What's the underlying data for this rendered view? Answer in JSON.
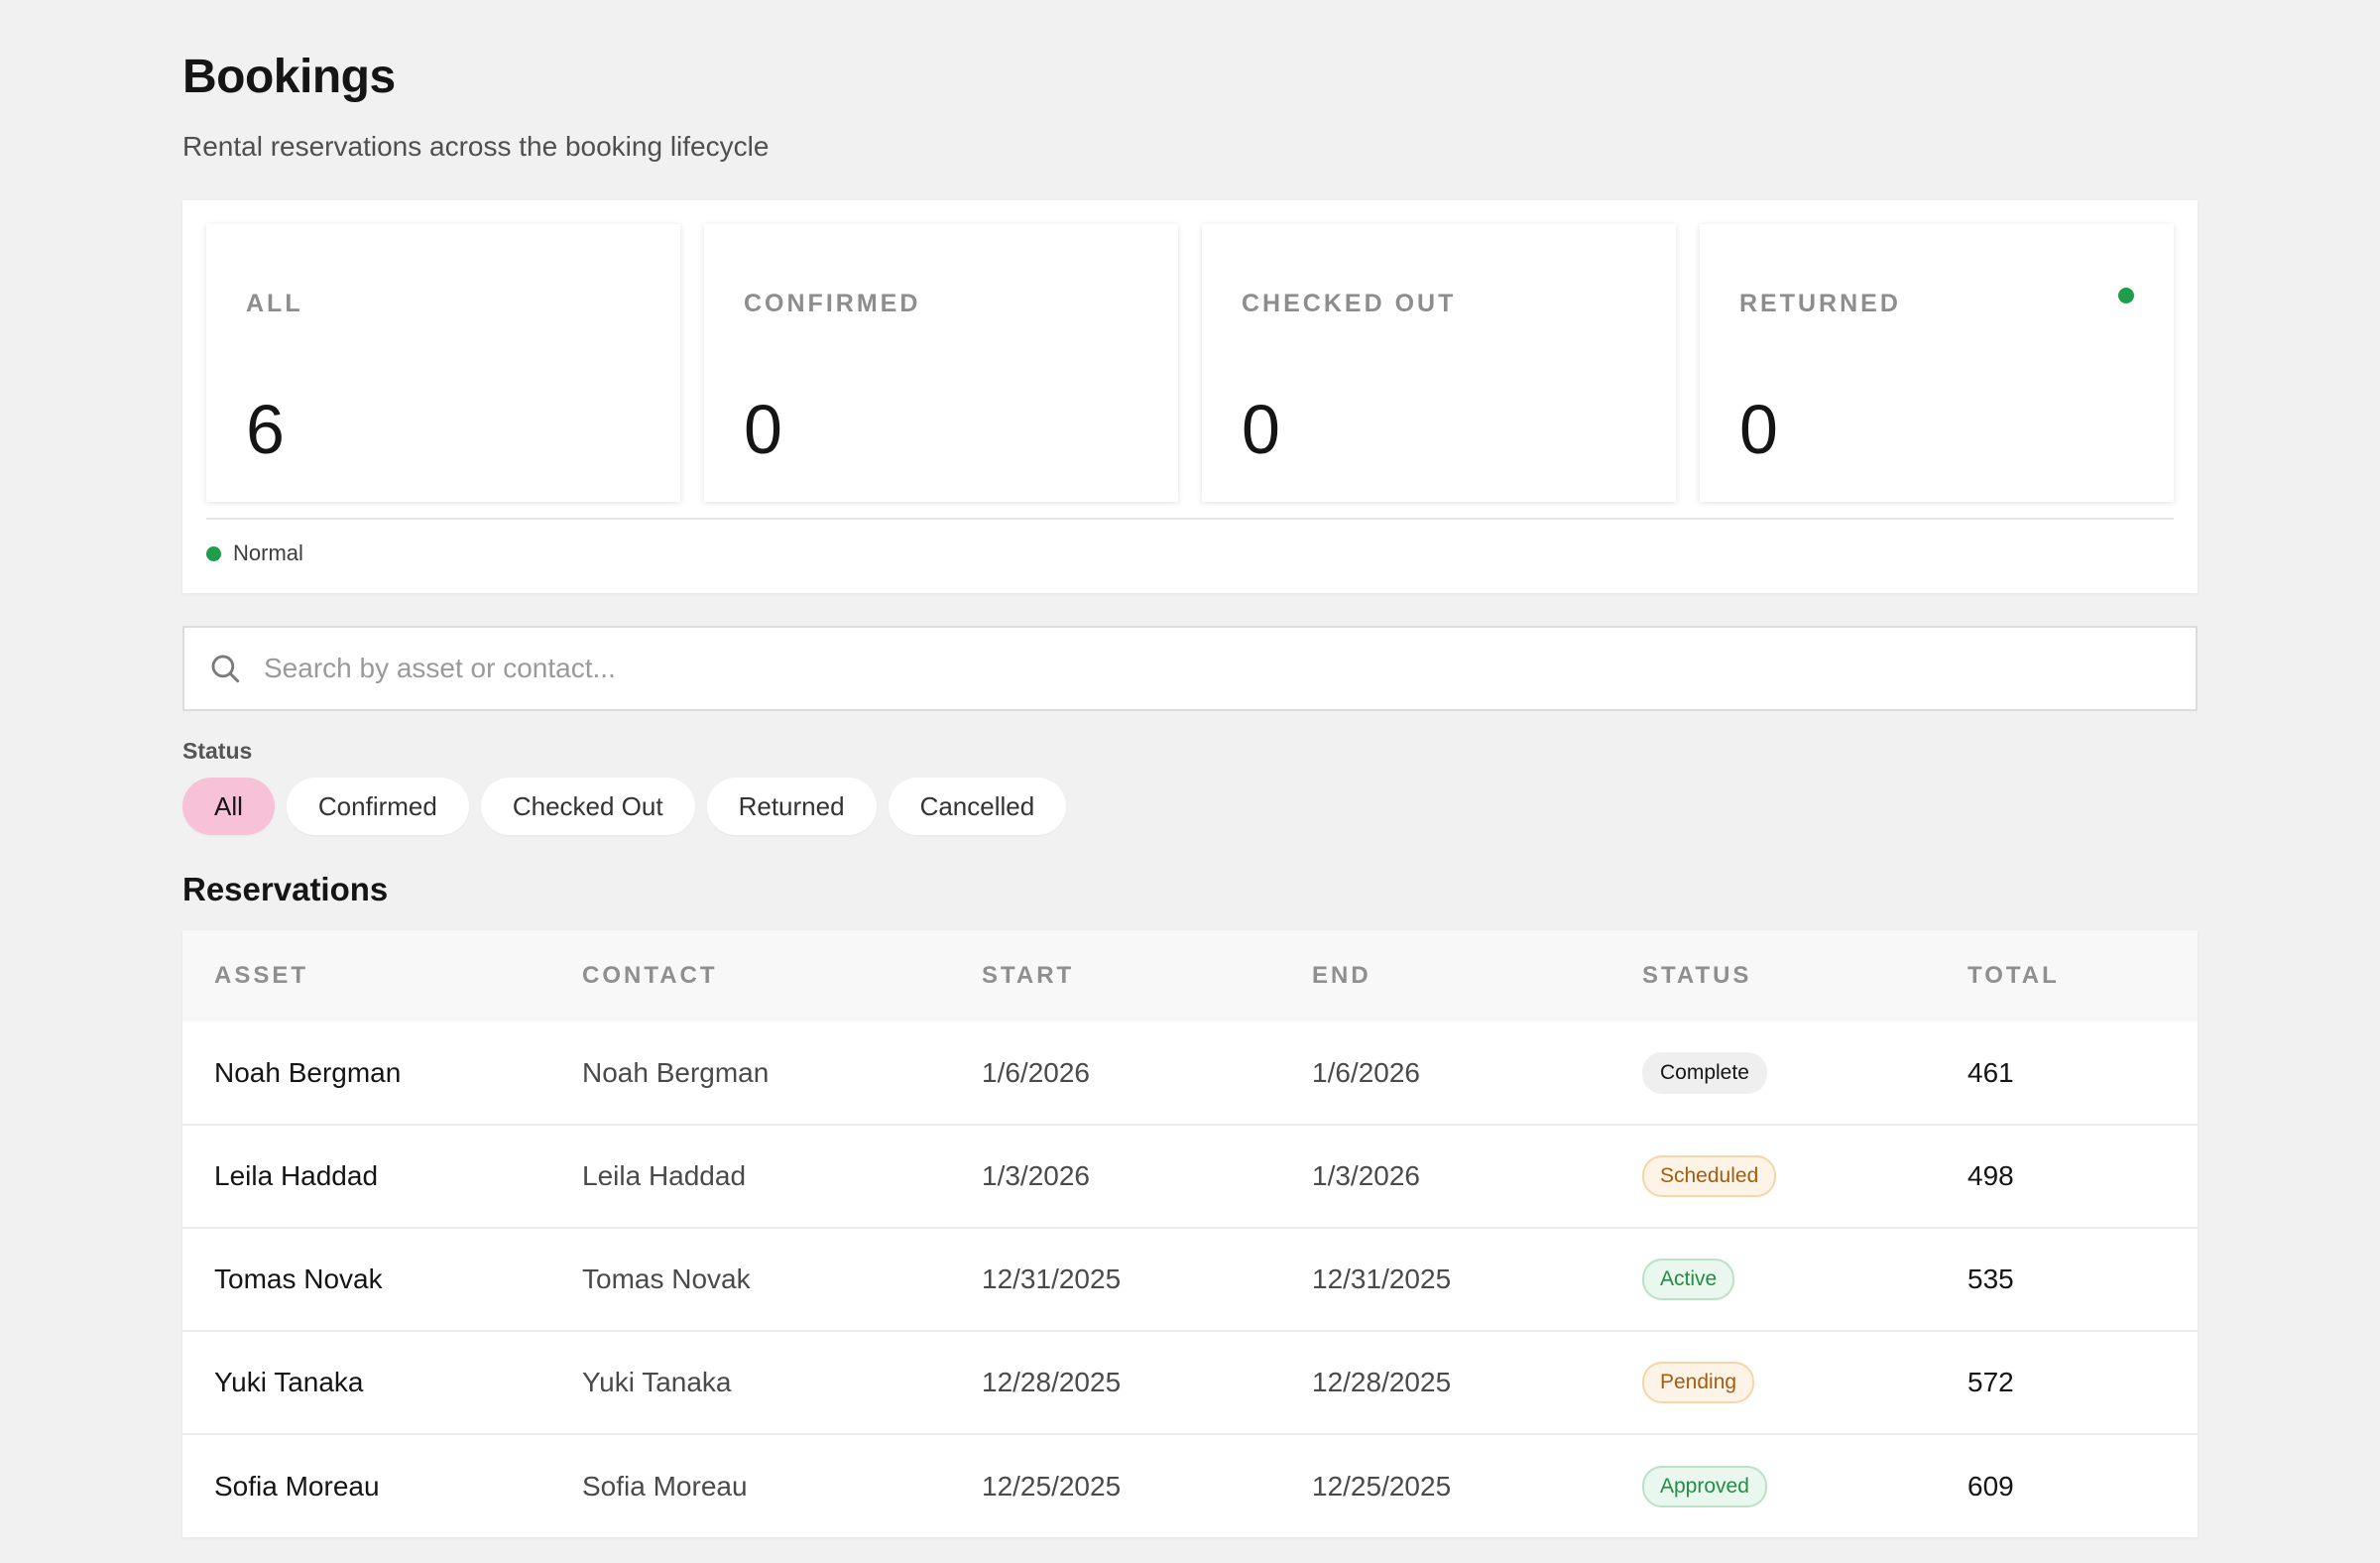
{
  "header": {
    "title": "Bookings",
    "subtitle": "Rental reservations across the booking lifecycle"
  },
  "stats": [
    {
      "label": "ALL",
      "value": "6"
    },
    {
      "label": "CONFIRMED",
      "value": "0"
    },
    {
      "label": "CHECKED OUT",
      "value": "0"
    },
    {
      "label": "RETURNED",
      "value": "0"
    }
  ],
  "status_legend": {
    "label": "Normal",
    "color": "#1e9e4a"
  },
  "search": {
    "placeholder": "Search by asset or contact...",
    "value": ""
  },
  "filters": {
    "label": "Status",
    "options": [
      "All",
      "Confirmed",
      "Checked Out",
      "Returned",
      "Cancelled"
    ],
    "selected": "All"
  },
  "reservations": {
    "title": "Reservations",
    "columns": [
      "ASSET",
      "CONTACT",
      "START",
      "END",
      "STATUS",
      "TOTAL"
    ],
    "rows": [
      {
        "asset": "Noah Bergman",
        "contact": "Noah Bergman",
        "start": "1/6/2026",
        "end": "1/6/2026",
        "status": "Complete",
        "total": "461"
      },
      {
        "asset": "Leila Haddad",
        "contact": "Leila Haddad",
        "start": "1/3/2026",
        "end": "1/3/2026",
        "status": "Scheduled",
        "total": "498"
      },
      {
        "asset": "Tomas Novak",
        "contact": "Tomas Novak",
        "start": "12/31/2025",
        "end": "12/31/2025",
        "status": "Active",
        "total": "535"
      },
      {
        "asset": "Yuki Tanaka",
        "contact": "Yuki Tanaka",
        "start": "12/28/2025",
        "end": "12/28/2025",
        "status": "Pending",
        "total": "572"
      },
      {
        "asset": "Sofia Moreau",
        "contact": "Sofia Moreau",
        "start": "12/25/2025",
        "end": "12/25/2025",
        "status": "Approved",
        "total": "609"
      }
    ]
  },
  "colors": {
    "accent_chip": "#f7c2d8",
    "success": "#1e9e4a",
    "warning": "#a95a0b",
    "background": "#f1f1f1"
  }
}
